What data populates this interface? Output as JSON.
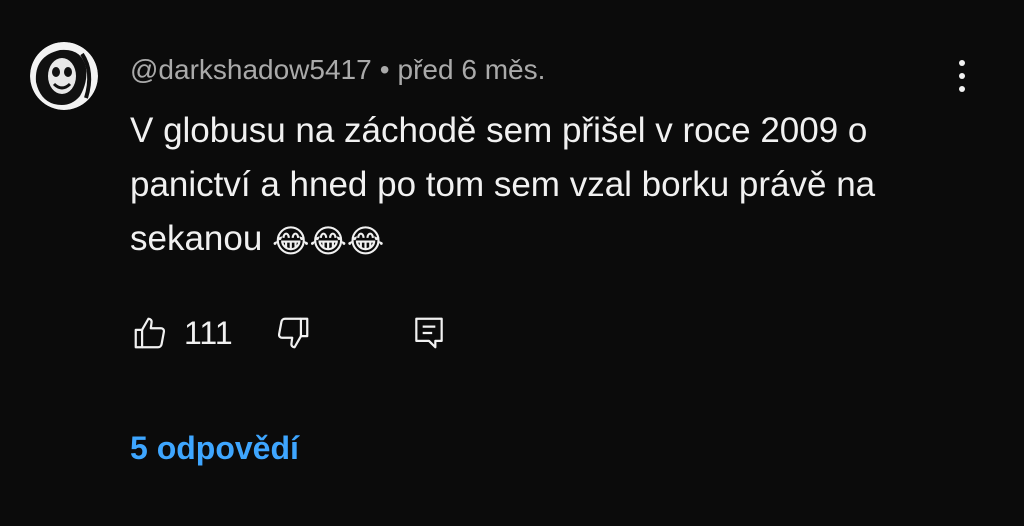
{
  "comment": {
    "author": "@darkshadow5417",
    "separator": "•",
    "timestamp": "před 6 měs.",
    "text": "V globusu na záchodě sem přišel v roce 2009 o panictví a hned po tom sem vzal borku právě na sekanou",
    "emoji": "😂😂😂",
    "like_count": "111",
    "replies_label": "5 odpovědí"
  },
  "icons": {
    "avatar": "avatar-image",
    "more": "more-vertical-icon",
    "like": "thumbs-up-icon",
    "dislike": "thumbs-down-icon",
    "reply": "reply-comment-icon"
  },
  "colors": {
    "background": "#0b0b0b",
    "text": "#f1f1f1",
    "meta": "#aaaaaa",
    "link": "#3ea6ff"
  }
}
